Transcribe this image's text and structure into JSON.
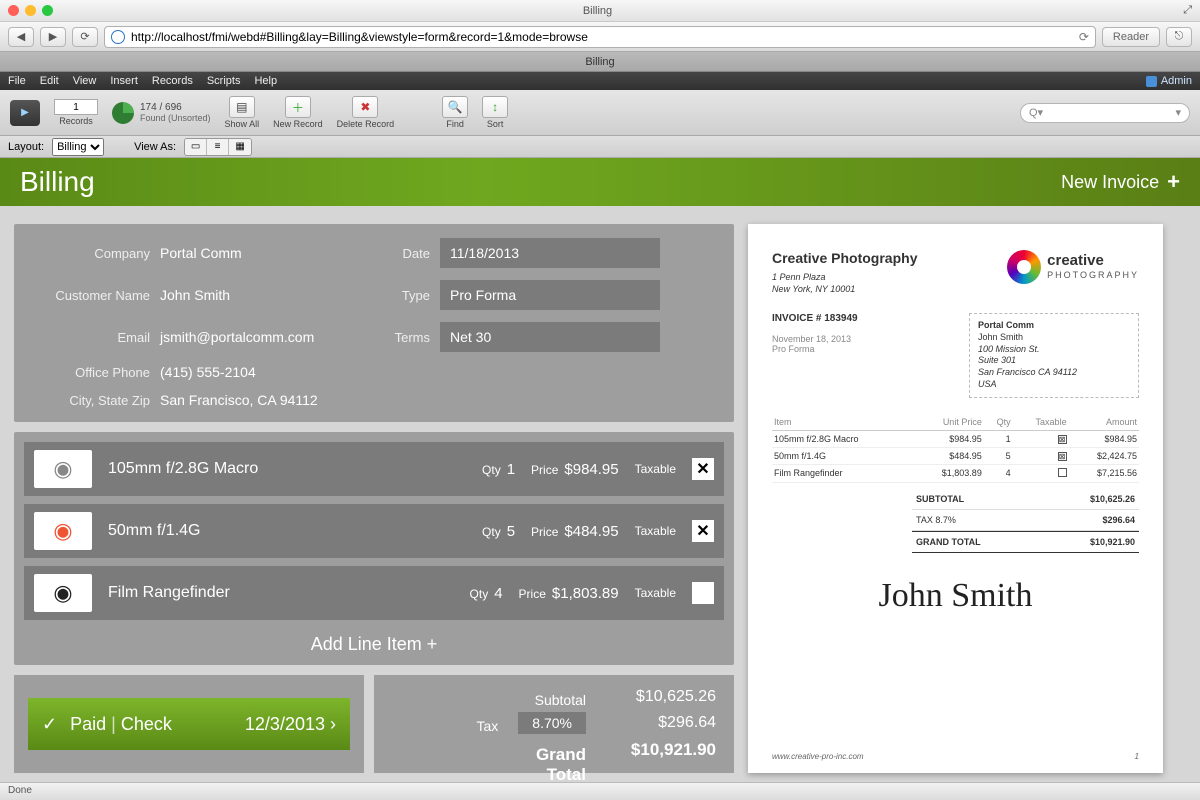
{
  "window": {
    "title": "Billing",
    "doc_tab": "Billing",
    "status": "Done"
  },
  "browser": {
    "url": "http://localhost/fmi/webd#Billing&lay=Billing&viewstyle=form&record=1&mode=browse",
    "reader": "Reader"
  },
  "menus": [
    "File",
    "Edit",
    "View",
    "Insert",
    "Records",
    "Scripts",
    "Help"
  ],
  "admin_label": "Admin",
  "toolbar": {
    "record_number": "1",
    "records_label": "Records",
    "found_count": "174 / 696",
    "found_label": "Found (Unsorted)",
    "show_all": "Show All",
    "new_record": "New Record",
    "delete_record": "Delete Record",
    "find": "Find",
    "sort": "Sort",
    "search_placeholder": "Q▾"
  },
  "layoutbar": {
    "layout_label": "Layout:",
    "layout_value": "Billing",
    "viewas_label": "View As:"
  },
  "banner": {
    "title": "Billing",
    "new_invoice": "New Invoice"
  },
  "customer": {
    "labels": {
      "company": "Company",
      "name": "Customer Name",
      "email": "Email",
      "phone": "Office Phone",
      "csz": "City, State Zip",
      "date": "Date",
      "type": "Type",
      "terms": "Terms"
    },
    "company": "Portal Comm",
    "name": "John Smith",
    "email": "jsmith@portalcomm.com",
    "phone": "(415) 555-2104",
    "csz": "San Francisco, CA 94112",
    "date": "11/18/2013",
    "type": "Pro Forma",
    "terms": "Net 30"
  },
  "line_labels": {
    "qty": "Qty",
    "price": "Price",
    "taxable": "Taxable",
    "add": "Add Line Item"
  },
  "lines": [
    {
      "name": "105mm f/2.8G Macro",
      "qty": "1",
      "price": "$984.95",
      "taxable": true,
      "icon_color": "#888"
    },
    {
      "name": "50mm f/1.4G",
      "qty": "5",
      "price": "$484.95",
      "taxable": true,
      "icon_color": "#e53"
    },
    {
      "name": "Film Rangefinder",
      "qty": "4",
      "price": "$1,803.89",
      "taxable": false,
      "icon_color": "#222"
    }
  ],
  "paid": {
    "status": "Paid",
    "method": "Check",
    "date": "12/3/2013"
  },
  "totals": {
    "subtotal_label": "Subtotal",
    "subtotal": "$10,625.26",
    "tax_label": "Tax",
    "tax_pct": "8.70%",
    "tax": "$296.64",
    "grand_label": "Grand Total",
    "grand": "$10,921.90"
  },
  "preview": {
    "vendor_name": "Creative Photography",
    "vendor_addr1": "1 Penn Plaza",
    "vendor_addr2": "New York, NY 10001",
    "logo_top": "creative",
    "logo_bottom": "PHOTOGRAPHY",
    "invoice_no_label": "INVOICE # 183949",
    "invoice_date": "November 18, 2013",
    "invoice_type": "Pro Forma",
    "billto": {
      "company": "Portal Comm",
      "name": "John Smith",
      "street": "100 Mission St.",
      "suite": "Suite 301",
      "csz": "San Francisco CA 94112",
      "country": "USA"
    },
    "columns": {
      "item": "Item",
      "unit": "Unit Price",
      "qty": "Qty",
      "tax": "Taxable",
      "amount": "Amount"
    },
    "rows": [
      {
        "item": "105mm f/2.8G Macro",
        "unit": "$984.95",
        "qty": "1",
        "tax": true,
        "amount": "$984.95"
      },
      {
        "item": "50mm f/1.4G",
        "unit": "$484.95",
        "qty": "5",
        "tax": true,
        "amount": "$2,424.75"
      },
      {
        "item": "Film Rangefinder",
        "unit": "$1,803.89",
        "qty": "4",
        "tax": false,
        "amount": "$7,215.56"
      }
    ],
    "subtotal_label": "SUBTOTAL",
    "subtotal": "$10,625.26",
    "tax_label": "TAX  8.7%",
    "tax": "$296.64",
    "grand_label": "GRAND TOTAL",
    "grand": "$10,921.90",
    "signature": "John Smith",
    "footer_site": "www.creative-pro-inc.com",
    "footer_page": "1"
  }
}
